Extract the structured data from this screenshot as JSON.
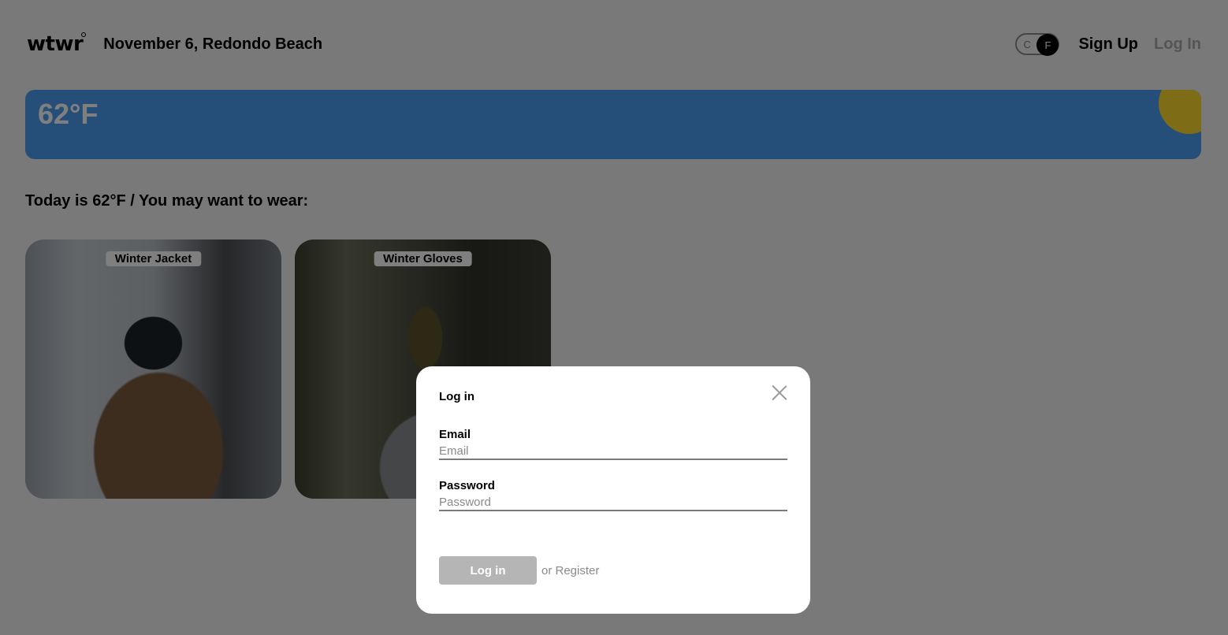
{
  "header": {
    "logo": "wtwr",
    "date_location": "November 6, Redondo Beach",
    "temp_toggle": {
      "c_label": "C",
      "f_label": "F",
      "selected": "F"
    },
    "signup_label": "Sign Up",
    "login_label": "Log In"
  },
  "weather": {
    "temperature": "62°F",
    "card_color": "#4a9ef0",
    "sun_color": "#ffd92e"
  },
  "suggestion": {
    "text": "Today is 62°F / You may want to wear:"
  },
  "items": [
    {
      "label": "Winter Jacket"
    },
    {
      "label": "Winter Gloves"
    }
  ],
  "modal": {
    "title": "Log in",
    "email_label": "Email",
    "email_placeholder": "Email",
    "email_value": "",
    "password_label": "Password",
    "password_placeholder": "Password",
    "password_value": "",
    "submit_label": "Log in",
    "register_link": "or Register",
    "close_icon": "close-icon"
  }
}
